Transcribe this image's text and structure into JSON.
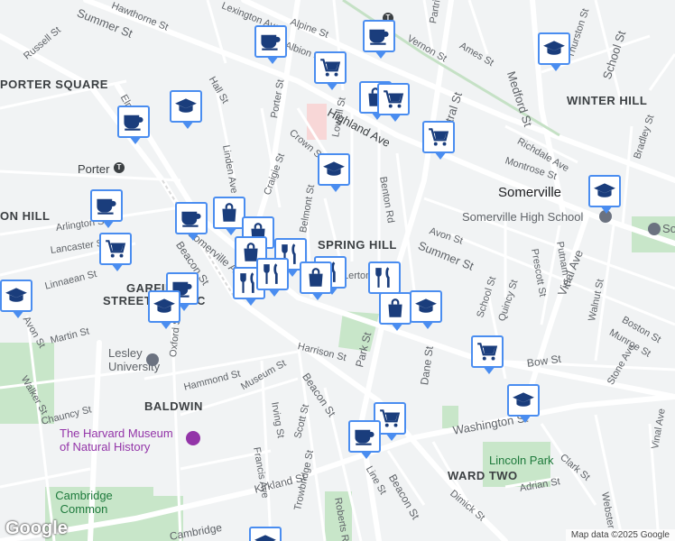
{
  "areas": [
    {
      "text": "PORTER SQUARE"
    },
    {
      "text": "WINTER HILL"
    },
    {
      "text": "ON HILL"
    },
    {
      "text": "SPRING HILL"
    },
    {
      "text": "GARFIE"
    },
    {
      "text": "STREET DISTRIC"
    },
    {
      "text": "BALDWIN"
    },
    {
      "text": "WARD TWO"
    }
  ],
  "places": [
    {
      "text": "Somerville"
    },
    {
      "text": "Porter"
    }
  ],
  "pois": [
    {
      "text": "Somerville High School"
    },
    {
      "text": "Lesley University"
    },
    {
      "text": "The Harvard Museum of Natural History"
    },
    {
      "text": "Lincoln Park"
    },
    {
      "text": "Cambridge Common"
    },
    {
      "text": "Somerv"
    }
  ],
  "streets": [
    "Summer St",
    "Russell St",
    "Hall St",
    "Elm St",
    "Linden Ave",
    "Porter St",
    "Crown St",
    "Lowell St",
    "Belmont St",
    "Craigie St",
    "Highland Ave",
    "Benton Rd",
    "Central St",
    "Richdale Ave",
    "Montrose St",
    "Medford St",
    "School St",
    "Thurston St",
    "Ames St",
    "Vernon St",
    "Partridge Ave",
    "Albion St",
    "Alpine St",
    "Lexington Ave",
    "Avon St",
    "Summer St",
    "Prescott St",
    "Putnam St",
    "Vinal Ave",
    "Walnut St",
    "Boston St",
    "Munroe St",
    "Bow St",
    "Stone Ave",
    "Quincy St",
    "School St",
    "Dane St",
    "Arlington St",
    "Lancaster St",
    "Linnaean St",
    "Martin St",
    "Walker St",
    "Avon St",
    "Chauncy St",
    "Oxford St",
    "Hammond St",
    "Museum St",
    "Harrison St",
    "Beacon St",
    "Park St",
    "Irving St",
    "Francis Ave",
    "Scott St",
    "Kirkland St",
    "Trowbridge St",
    "Roberts Rd",
    "Line St",
    "Beacon St",
    "Dimick St",
    "Washington St",
    "Clark St",
    "Adrian St",
    "Webster",
    "Cambridge",
    "Hawthorne St",
    "Vinal Ave",
    "Bradley St",
    "Somerville Ave",
    "Beacon St",
    "Lerton"
  ],
  "logo": "Google",
  "attribution": "Map data ©2025 Google",
  "icon_names": [
    "coffee-icon",
    "grocery-cart-icon",
    "shopping-bag-icon",
    "school-icon",
    "restaurant-icon"
  ],
  "colors": {
    "pin_border": "#4a8df0",
    "pin_icon": "#1a3d7c",
    "park": "#c8e6c9",
    "road": "#ffffff",
    "background": "#f1f3f4"
  }
}
